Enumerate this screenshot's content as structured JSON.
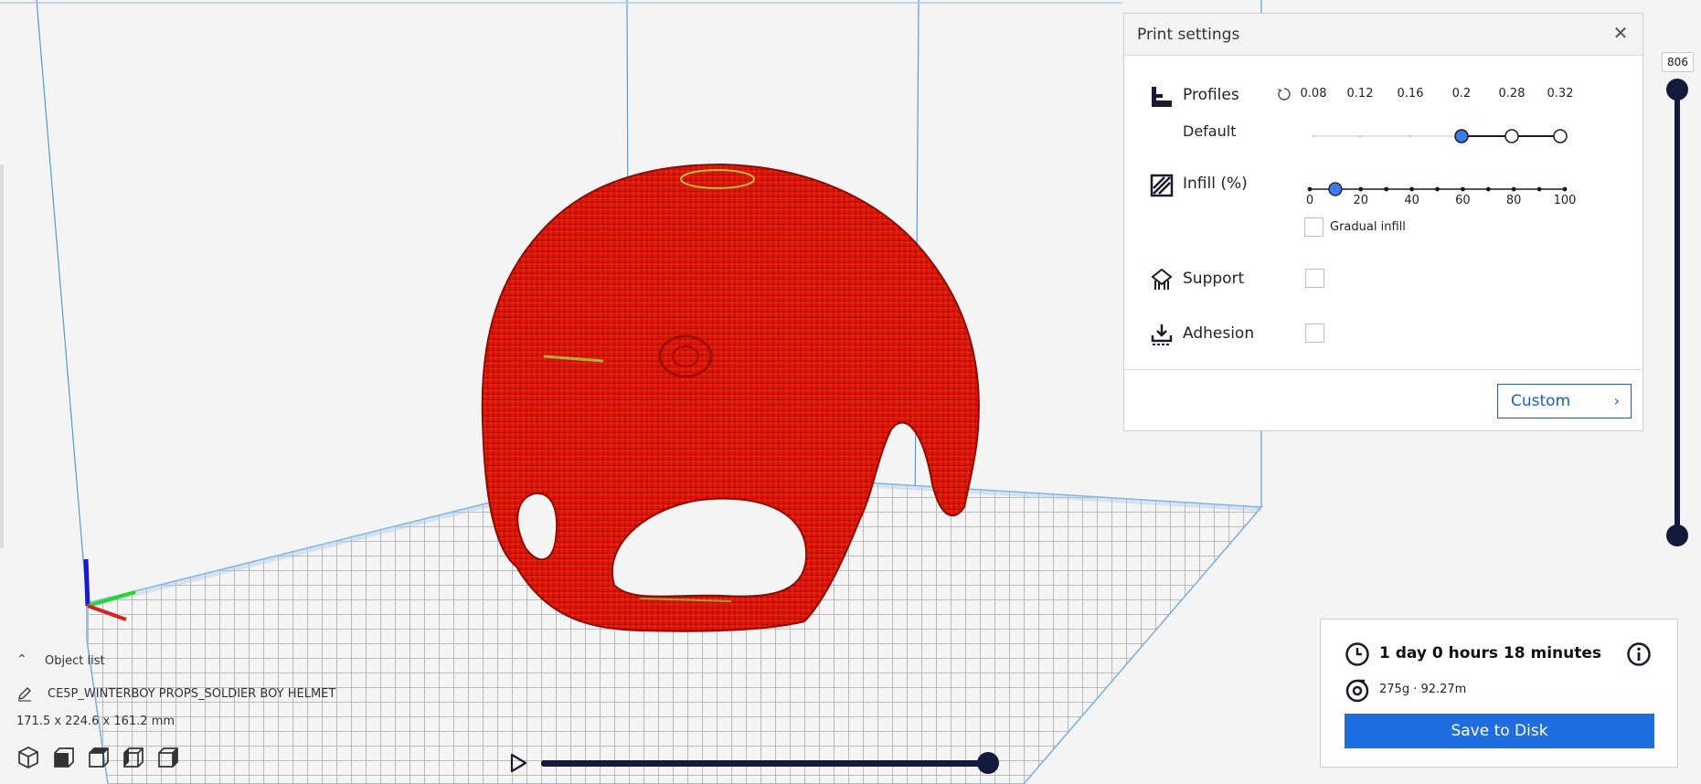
{
  "print_settings": {
    "title": "Print settings",
    "close_icon": "close-icon",
    "profiles": {
      "label": "Profiles",
      "profile_name": "Default",
      "layer_heights": [
        "0.08",
        "0.12",
        "0.16",
        "0.2",
        "0.28",
        "0.32"
      ],
      "selected_layer_height": "0.2"
    },
    "infill": {
      "label": "Infill (%)",
      "tick_labels": [
        "0",
        "20",
        "40",
        "60",
        "80",
        "100"
      ],
      "value": 10,
      "gradual_label": "Gradual infill",
      "gradual_checked": false
    },
    "support": {
      "label": "Support",
      "checked": false
    },
    "adhesion": {
      "label": "Adhesion",
      "checked": false
    },
    "custom_button": "Custom"
  },
  "layer_slider": {
    "value": "806"
  },
  "estimate": {
    "time": "1 day 0 hours 18 minutes",
    "material": "275g · 92.27m",
    "save_button": "Save to Disk"
  },
  "object_list": {
    "header": "Object list",
    "object_name": "CE5P_WINTERBOY PROPS_SOLDIER BOY HELMET",
    "dimensions": "171.5 x 224.6 x 161.2 mm"
  },
  "view_buttons": [
    "3d-view-icon",
    "front-view-icon",
    "top-view-icon",
    "left-view-icon",
    "right-view-icon"
  ],
  "simulation": {
    "progress_percent": 100
  },
  "colors": {
    "accent": "#1f6de0",
    "slider_dark": "#141a3c",
    "model_red": "#e21a0a",
    "handle_blue": "#3b7be8"
  }
}
